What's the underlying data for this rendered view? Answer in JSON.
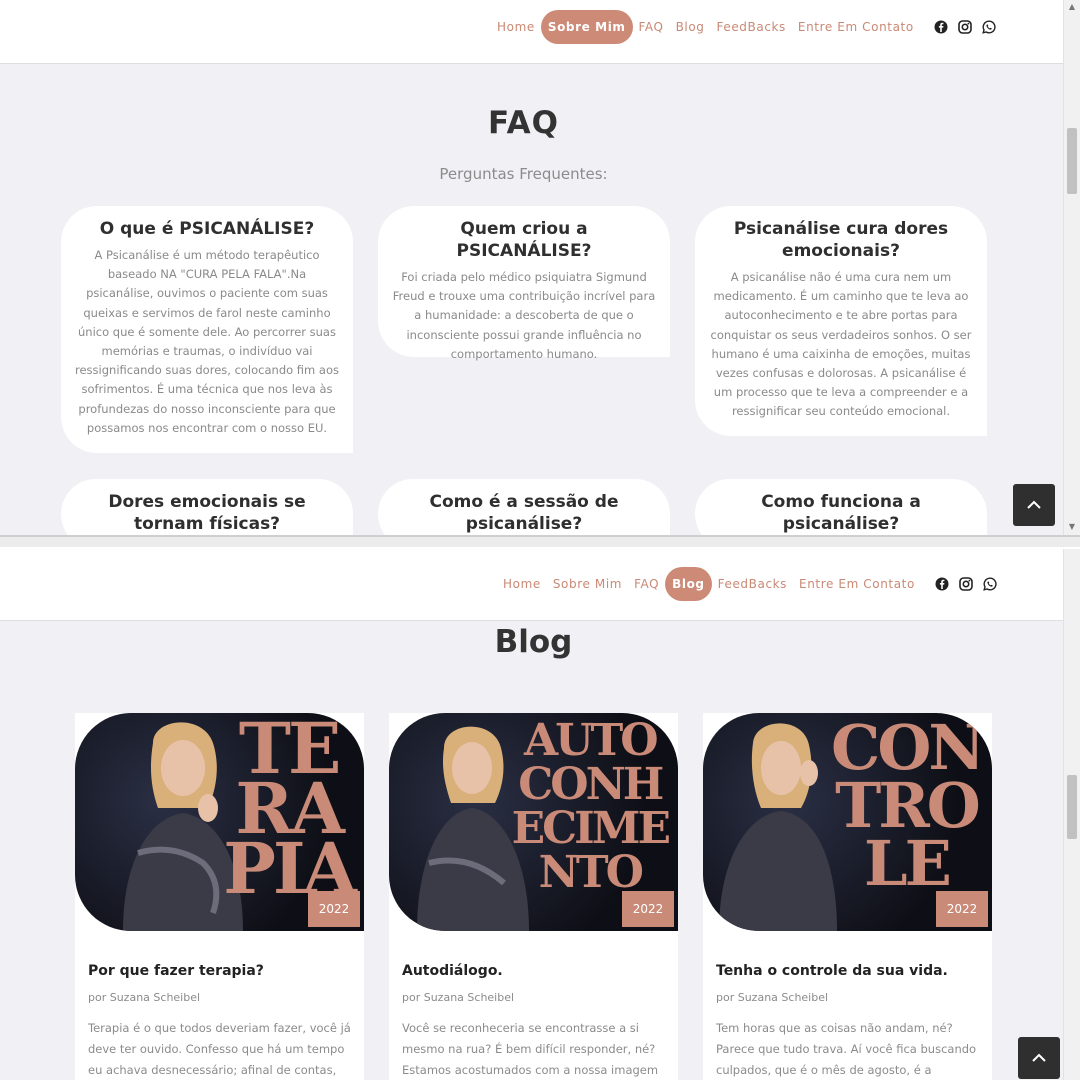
{
  "nav": {
    "items": [
      "Home",
      "Sobre Mim",
      "FAQ",
      "Blog",
      "FeedBacks",
      "Entre Em Contato"
    ]
  },
  "social_icons": [
    "facebook-icon",
    "instagram-icon",
    "whatsapp-icon"
  ],
  "colors": {
    "accent": "#cd8a76",
    "dark": "#2f2f2f",
    "background": "#f1f1f5"
  },
  "faq": {
    "title": "FAQ",
    "subtitle": "Perguntas Frequentes:",
    "items": [
      {
        "question": "O que é PSICANÁLISE?",
        "answer": "A Psicanálise é um método terapêutico baseado NA \"CURA PELA FALA\".Na psicanálise, ouvimos o paciente com suas queixas e servimos de farol neste caminho único que é somente dele. Ao percorrer suas memórias e traumas, o indivíduo vai ressignificando suas dores, colocando fim aos sofrimentos. É uma técnica que nos leva às profundezas do nosso inconsciente para que possamos nos encontrar com o nosso EU."
      },
      {
        "question": "Quem criou a PSICANÁLISE?",
        "answer": "Foi criada pelo médico psiquiatra Sigmund Freud e trouxe uma contribuição incrível para a humanidade: a descoberta de que o inconsciente possui grande influência no comportamento humano."
      },
      {
        "question": "Psicanálise cura dores emocionais?",
        "answer": "A psicanálise não é uma cura nem um medicamento. É um caminho que te leva ao autoconhecimento e te abre portas para conquistar os seus verdadeiros sonhos. O ser humano é uma caixinha de emoções, muitas vezes confusas e dolorosas. A psicanálise é um processo que te leva a compreender e a ressignificar seu conteúdo emocional."
      },
      {
        "question": "Dores emocionais se tornam físicas?",
        "answer": ""
      },
      {
        "question": "Como é a sessão de psicanálise?",
        "answer": ""
      },
      {
        "question": "Como funciona a psicanálise?",
        "answer": ""
      }
    ]
  },
  "blog": {
    "title": "Blog",
    "posts": [
      {
        "poster": [
          "TE",
          "RA",
          "PIA"
        ],
        "year": "2022",
        "title": "Por que fazer terapia?",
        "author": "por Suzana Scheibel",
        "excerpt": [
          "Terapia é o que todos deveriam fazer, você já",
          "deve ter ouvido. Confesso que há um tempo",
          "eu achava desnecessário; afinal de contas,"
        ]
      },
      {
        "poster": [
          "AUTO",
          "CONH",
          "ECIME",
          "NTO"
        ],
        "year": "2022",
        "title": "Autodiálogo.",
        "author": "por Suzana Scheibel",
        "excerpt": [
          "Você se reconheceria se encontrasse a si",
          "mesmo na rua? É bem difícil responder, né?",
          "Estamos acostumados com a nossa imagem"
        ]
      },
      {
        "poster": [
          "CON",
          "TRO",
          "LE"
        ],
        "year": "2022",
        "title": "Tenha o controle da sua vida.",
        "author": "por Suzana Scheibel",
        "excerpt": [
          "Tem horas que as coisas não andam, né?",
          "Parece que tudo trava. Aí você fica buscando",
          "culpados, que é o mês de agosto, é a internet"
        ]
      }
    ]
  }
}
